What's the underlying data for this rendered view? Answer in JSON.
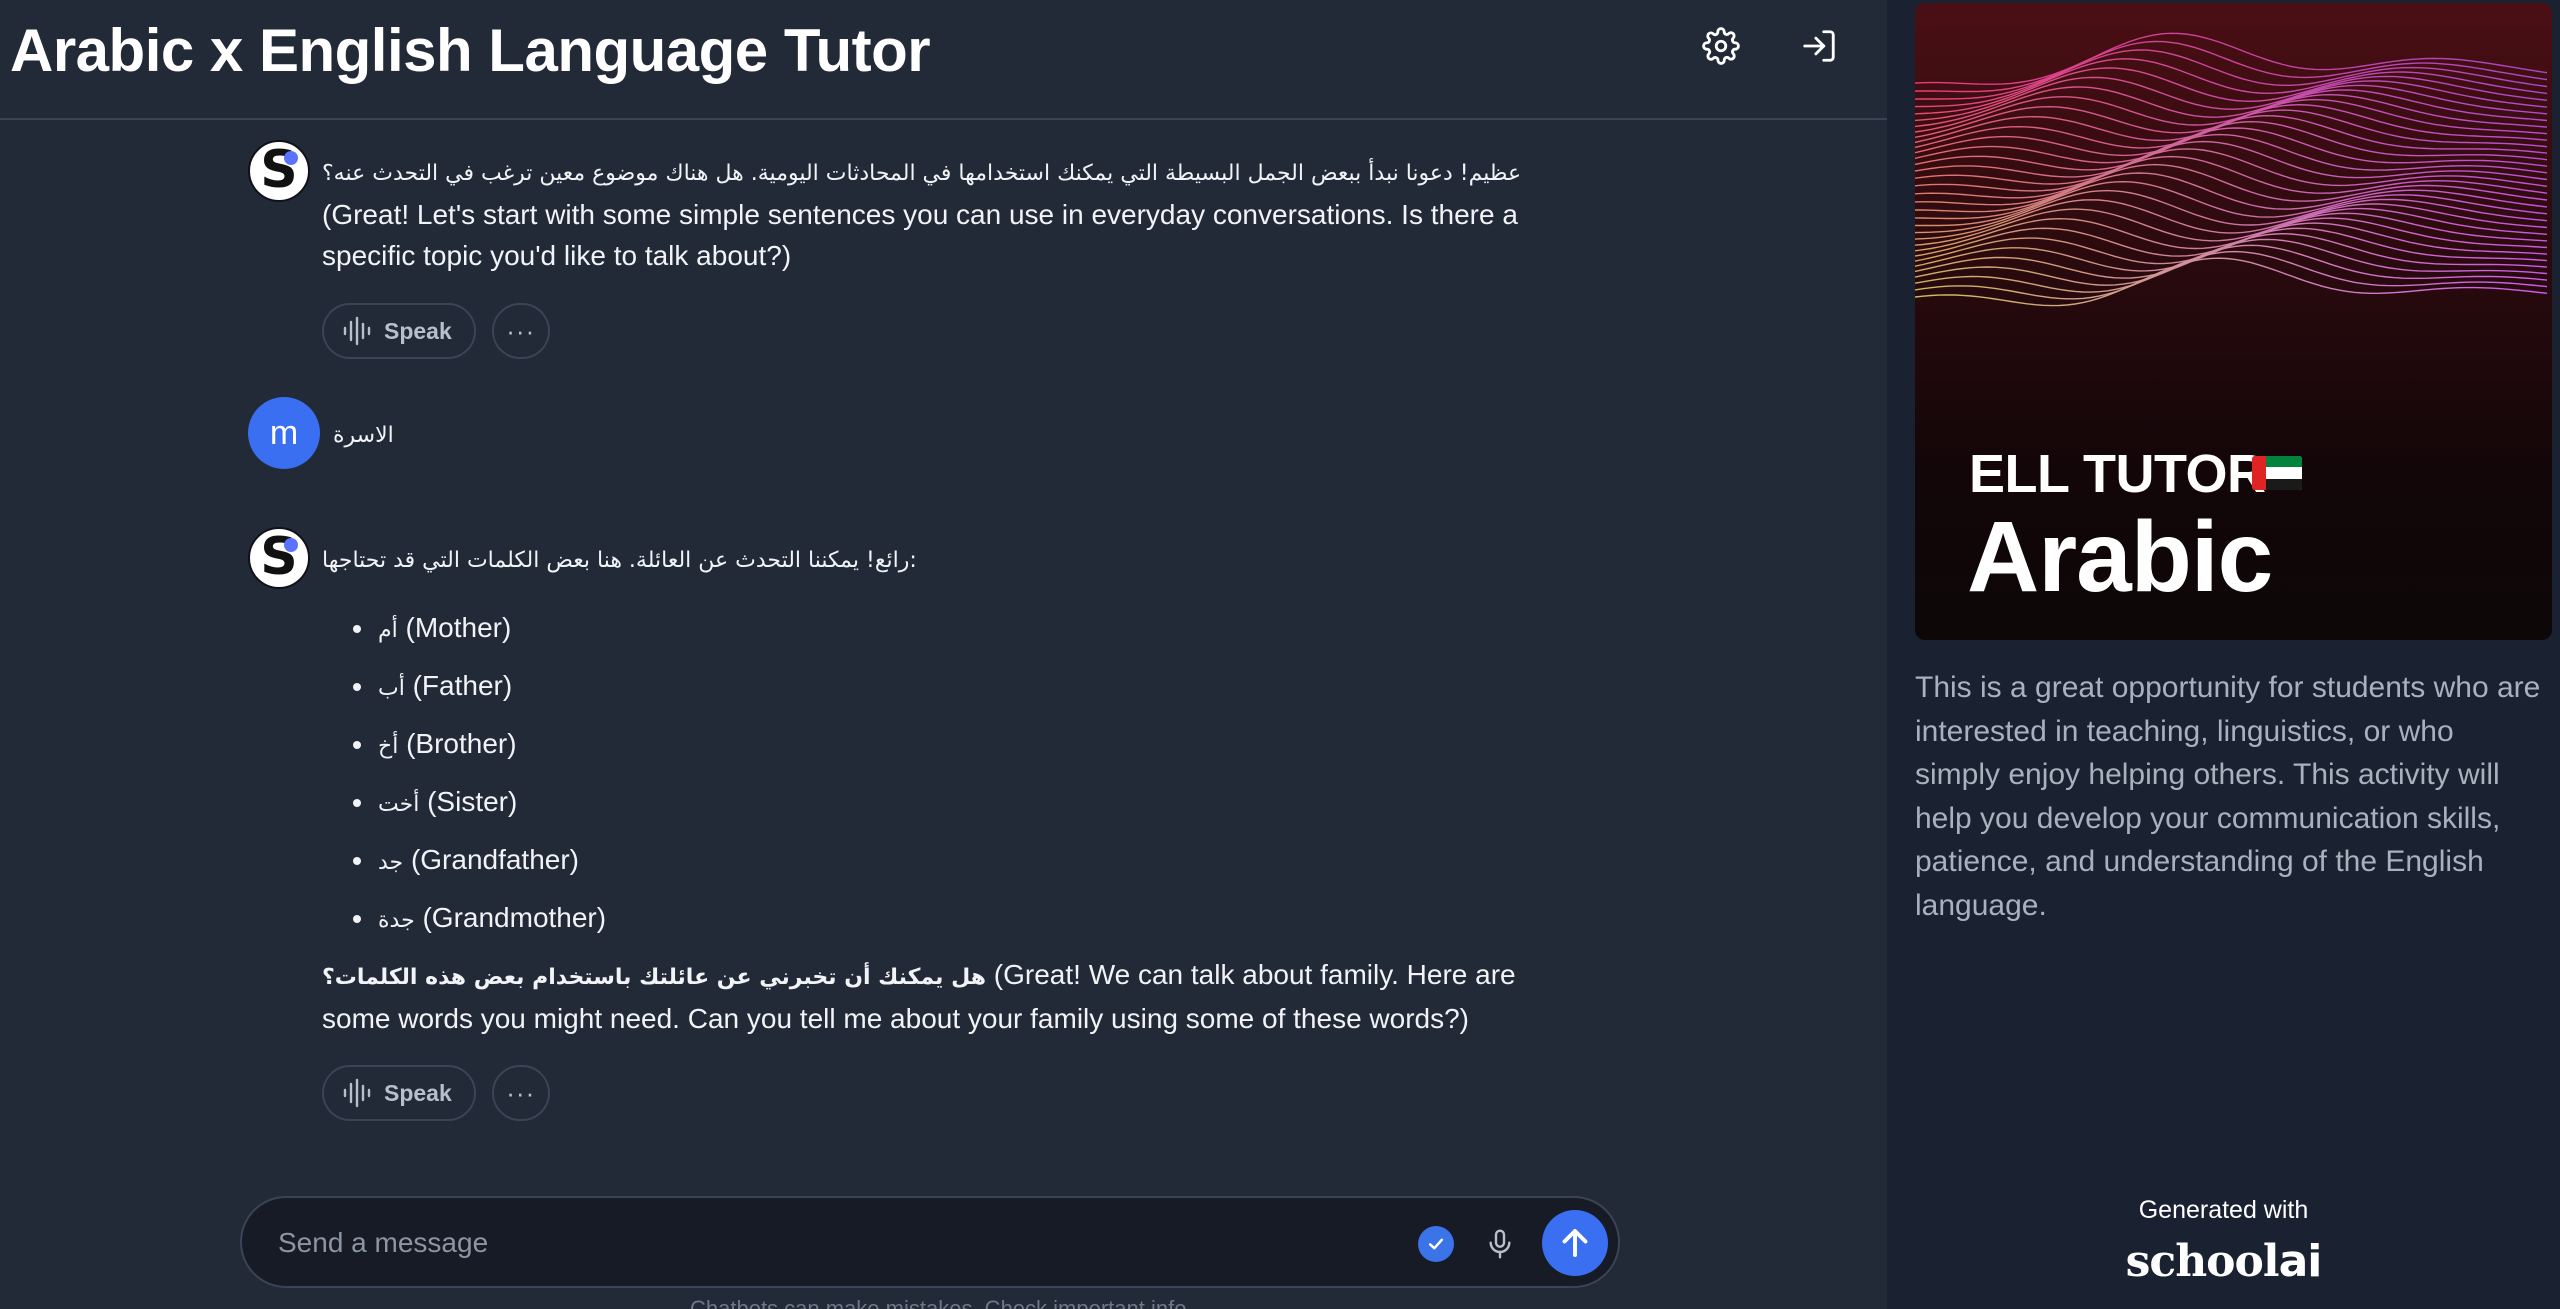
{
  "header": {
    "title": "Arabic x English Language Tutor"
  },
  "messages": [
    {
      "role": "assistant",
      "arabic": "عظيم! دعونا نبدأ ببعض الجمل البسيطة التي يمكنك استخدامها في المحادثات اليومية. هل هناك موضوع معين ترغب في التحدث عنه؟",
      "english": "(Great! Let's start with some simple sentences you can use in everyday conversations. Is there a specific topic you'd like to talk about?)"
    },
    {
      "role": "user",
      "avatar_letter": "m",
      "text": "الاسرة"
    },
    {
      "role": "assistant",
      "intro": "رائع! يمكننا التحدث عن العائلة. هنا بعض الكلمات التي قد تحتاجها:",
      "words": [
        {
          "ar": "أم",
          "en": "(Mother)"
        },
        {
          "ar": "أب",
          "en": "(Father)"
        },
        {
          "ar": "أخ",
          "en": "(Brother)"
        },
        {
          "ar": "أخت",
          "en": "(Sister)"
        },
        {
          "ar": "جد",
          "en": "(Grandfather)"
        },
        {
          "ar": "جدة",
          "en": "(Grandmother)"
        }
      ],
      "question_ar": "هل يمكنك أن تخبرني عن عائلتك باستخدام بعض هذه الكلمات؟",
      "question_en": "(Great! We can talk about family. Here are some words you might need. Can you tell me about your family using some of these words?)"
    }
  ],
  "actions": {
    "speak_label": "Speak",
    "more_label": "···"
  },
  "composer": {
    "placeholder": "Send a message",
    "value": ""
  },
  "footnote": "Chatbots can make mistakes. Check important info.",
  "sidebar": {
    "cover_subtitle": "ELL TUTOR",
    "cover_title": "Arabic",
    "description": "This is a great opportunity for students who are interested in teaching, linguistics, or who simply enjoy helping others. This activity will help you develop your communication skills, patience, and understanding of the English language.",
    "generated_label": "Generated with",
    "brand": "school",
    "brand_suffix": "ai"
  },
  "colors": {
    "background": "#222a38",
    "sidebar": "#1a2130",
    "accent": "#3b6ff2",
    "text": "#f1f3f6",
    "muted": "#a9b1bd"
  },
  "icons": [
    "gear-icon",
    "logout-icon",
    "soundwave-icon",
    "ellipsis-icon",
    "check-icon",
    "microphone-icon",
    "arrow-up-icon",
    "uae-flag-icon"
  ]
}
